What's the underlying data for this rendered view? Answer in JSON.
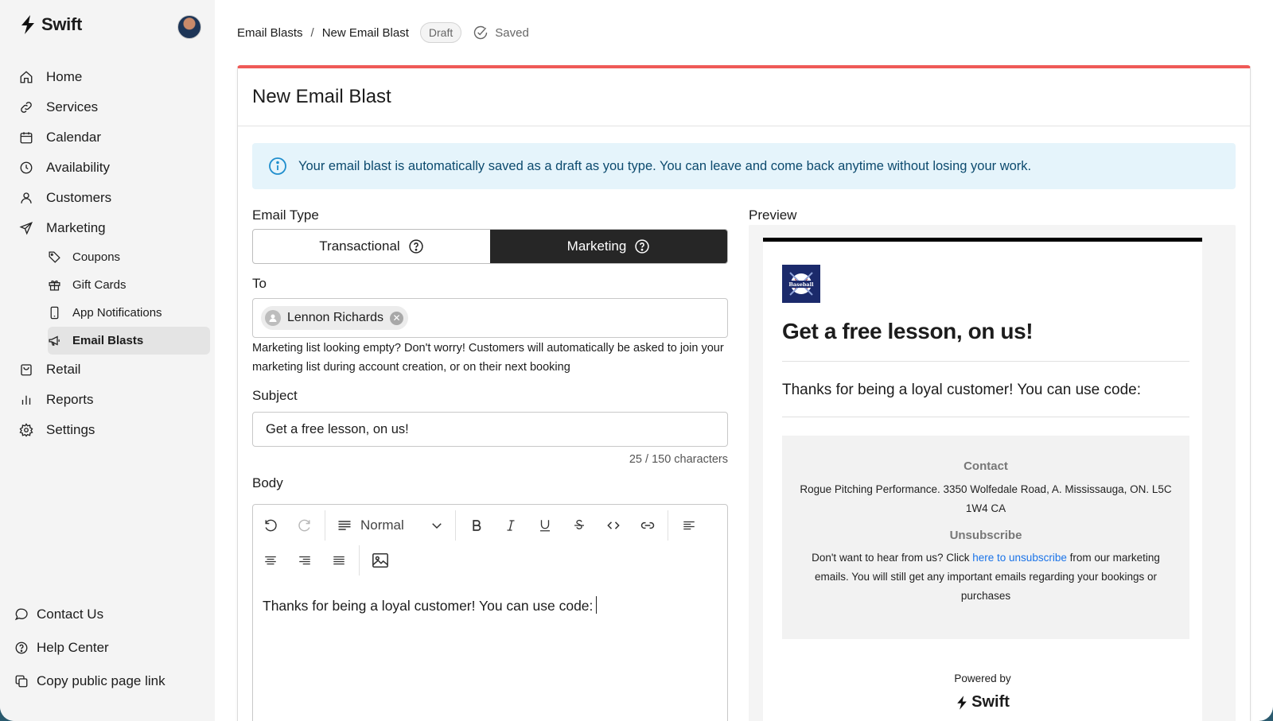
{
  "brand": {
    "name": "Swift"
  },
  "sidebar": {
    "items": [
      {
        "label": "Home",
        "icon": "home-icon"
      },
      {
        "label": "Services",
        "icon": "link-icon"
      },
      {
        "label": "Calendar",
        "icon": "calendar-icon"
      },
      {
        "label": "Availability",
        "icon": "clock-icon"
      },
      {
        "label": "Customers",
        "icon": "user-icon"
      },
      {
        "label": "Marketing",
        "icon": "send-icon"
      }
    ],
    "sub_items": [
      {
        "label": "Coupons",
        "icon": "tag-icon"
      },
      {
        "label": "Gift Cards",
        "icon": "gift-icon"
      },
      {
        "label": "App Notifications",
        "icon": "phone-icon"
      },
      {
        "label": "Email Blasts",
        "icon": "megaphone-icon",
        "active": true
      }
    ],
    "items_after": [
      {
        "label": "Retail",
        "icon": "bag-icon"
      },
      {
        "label": "Reports",
        "icon": "bar-chart-icon"
      },
      {
        "label": "Settings",
        "icon": "gear-icon"
      }
    ],
    "bottom": [
      {
        "label": "Contact Us",
        "icon": "chat-icon"
      },
      {
        "label": "Help Center",
        "icon": "help-icon"
      },
      {
        "label": "Copy public page link",
        "icon": "copy-icon"
      }
    ]
  },
  "header": {
    "breadcrumb": [
      "Email Blasts",
      "New Email Blast"
    ],
    "separator": "/",
    "status_badge": "Draft",
    "saved_label": "Saved"
  },
  "form": {
    "title": "New Email Blast",
    "info": "Your email blast is automatically saved as a draft as you type. You can leave and come back anytime without losing your work.",
    "email_type_label": "Email Type",
    "email_types": [
      "Transactional",
      "Marketing"
    ],
    "selected_type": "Marketing",
    "to_label": "To",
    "recipient": "Lennon Richards",
    "helper": "Marketing list looking empty? Don't worry! Customers will automatically be asked to join your marketing list during account creation, or on their next booking",
    "subject_label": "Subject",
    "subject_value": "Get a free lesson, on us!",
    "char_count": "25 / 150 characters",
    "body_label": "Body",
    "text_style": "Normal",
    "body_text": "Thanks for being a loyal customer! You can use code:"
  },
  "preview": {
    "label": "Preview",
    "heading": "Get a free lesson, on us!",
    "body": "Thanks for being a loyal customer! You can use code:",
    "contact_title": "Contact",
    "contact_text": "Rogue Pitching Performance. 3350 Wolfedale Road, A. Mississauga, ON. L5C 1W4 CA",
    "unsubscribe_title": "Unsubscribe",
    "unsubscribe_before": "Don't want to hear from us? Click ",
    "unsubscribe_link": "here to unsubscribe",
    "unsubscribe_after": " from our marketing emails. You will still get any important emails regarding your bookings or purchases",
    "powered_by": "Powered by",
    "powered_brand": "Swift",
    "logo_text": "Baseball"
  },
  "colors": {
    "accent_top": "#ef5a57",
    "info_bg": "#e5f4fb",
    "segment_selected": "#262626",
    "link": "#1a73e8"
  }
}
